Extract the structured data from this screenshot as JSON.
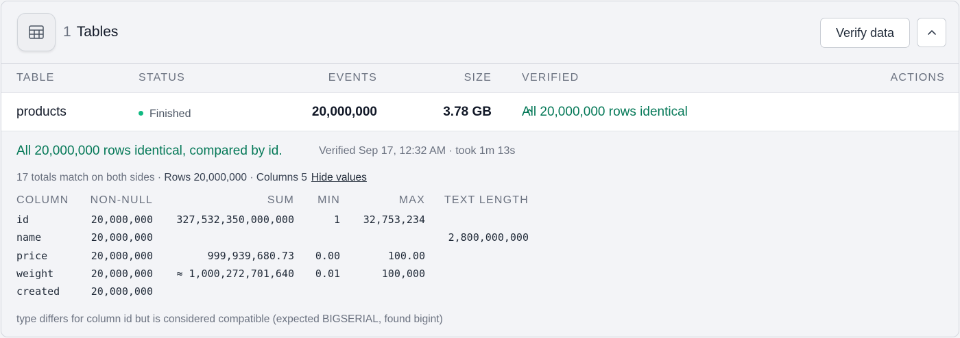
{
  "header": {
    "count": "1",
    "title": "Tables",
    "verify_label": "Verify data",
    "icons": {
      "table": "table-icon",
      "collapse": "chevron-up-icon"
    }
  },
  "columns": {
    "table": "Table",
    "status": "Status",
    "events": "Events",
    "size": "Size",
    "verified": "Verified",
    "actions": "Actions"
  },
  "row": {
    "name": "products",
    "status": "Finished",
    "events": "20,000,000",
    "size": "3.78 GB",
    "verified": "All 20,000,000 rows identical"
  },
  "detail": {
    "summary": "All 20,000,000 rows identical, compared by id.",
    "verified_meta": "Verified Sep 17, 12:32 AM · took 1m 13s",
    "totals_text": "17 totals match on both sides · ",
    "rows_text": "Rows 20,000,000",
    "sep": " · ",
    "columns_text": "Columns 5",
    "hide_label": "Hide values",
    "stats_headers": {
      "column": "COLUMN",
      "non_null": "NON-NULL",
      "sum": "SUM",
      "min": "MIN",
      "max": "MAX",
      "text_length": "TEXT LENGTH"
    },
    "stats_rows": [
      {
        "column": "id",
        "non_null": "20,000,000",
        "sum": "327,532,350,000,000",
        "min": "1",
        "max": "32,753,234",
        "text_length": ""
      },
      {
        "column": "name",
        "non_null": "20,000,000",
        "sum": "",
        "min": "",
        "max": "",
        "text_length": "2,800,000,000"
      },
      {
        "column": "price",
        "non_null": "20,000,000",
        "sum": "999,939,680.73",
        "min": "0.00",
        "max": "100.00",
        "text_length": ""
      },
      {
        "column": "weight",
        "non_null": "20,000,000",
        "sum": "≈ 1,000,272,701,640",
        "min": "0.01",
        "max": "100,000",
        "text_length": ""
      },
      {
        "column": "created",
        "non_null": "20,000,000",
        "sum": "",
        "min": "",
        "max": "",
        "text_length": ""
      }
    ],
    "note": "type differs for column id but is considered compatible (expected BIGSERIAL, found bigint)"
  },
  "colors": {
    "success": "#047857",
    "status_dot": "#10b981"
  }
}
